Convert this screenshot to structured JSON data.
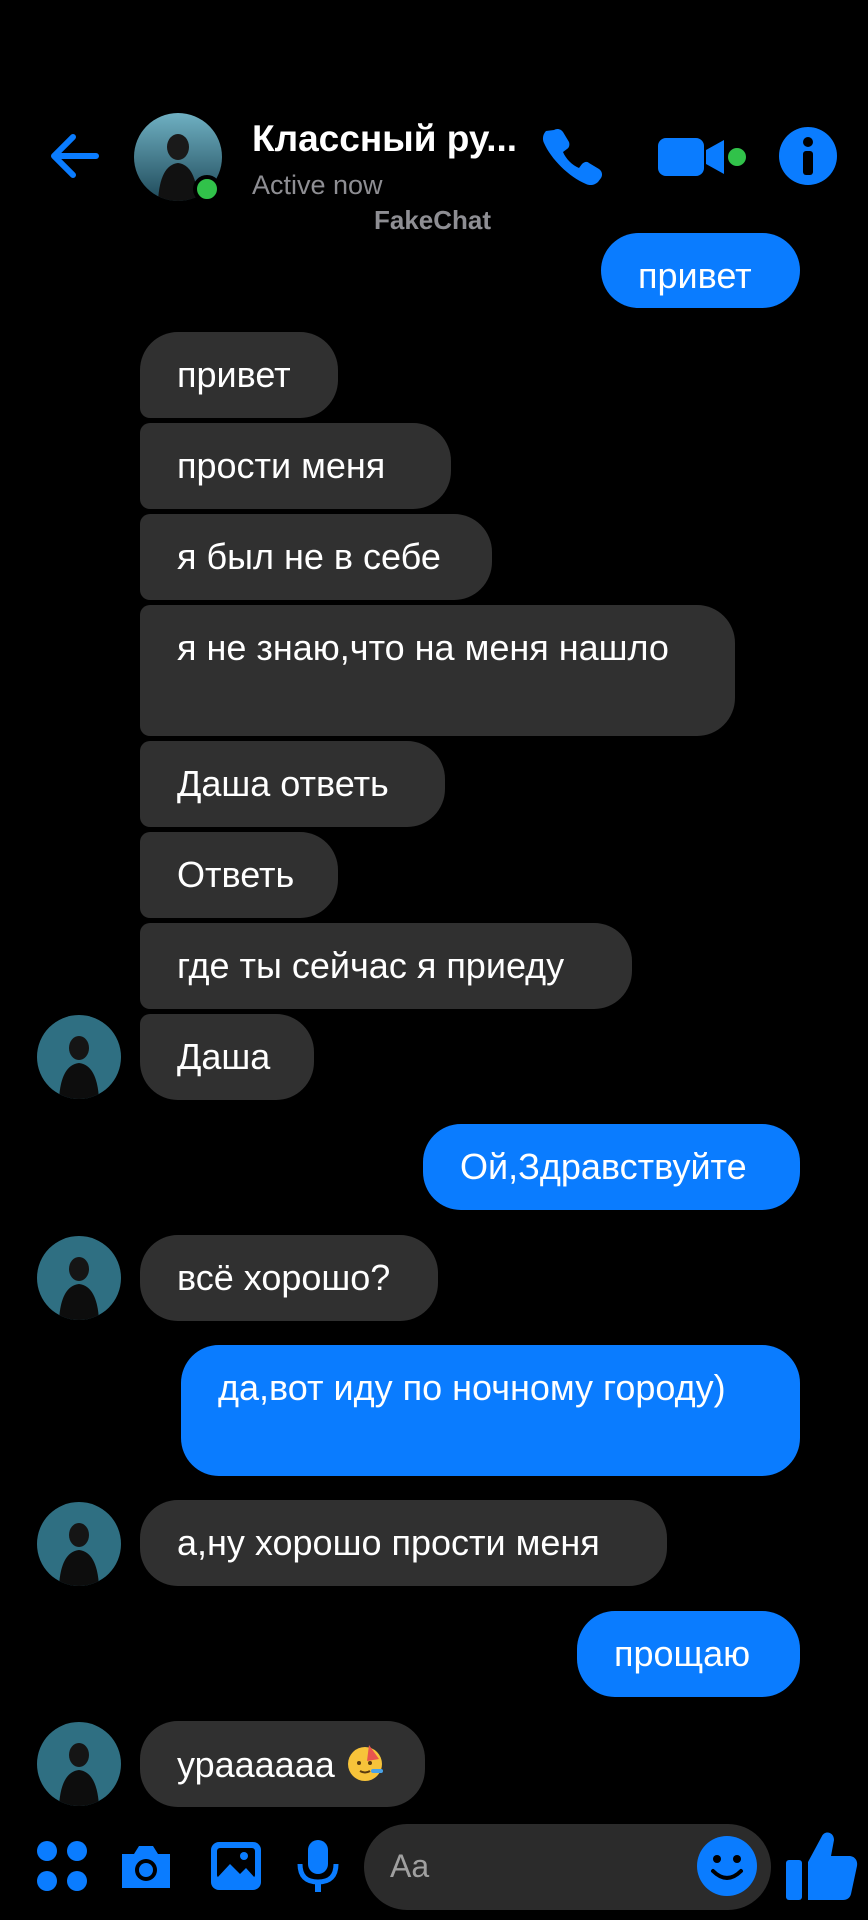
{
  "header": {
    "contact_name": "Классный ру...",
    "status": "Active now",
    "watermark": "FakeChat"
  },
  "messages": [
    {
      "dir": "out",
      "text": "привет"
    },
    {
      "dir": "in",
      "text": "привет"
    },
    {
      "dir": "in",
      "text": "прости меня"
    },
    {
      "dir": "in",
      "text": "я был не в себе"
    },
    {
      "dir": "in",
      "text": "я не знаю,что на меня нашло"
    },
    {
      "dir": "in",
      "text": "Даша ответь"
    },
    {
      "dir": "in",
      "text": "Ответь"
    },
    {
      "dir": "in",
      "text": "где ты сейчас я приеду"
    },
    {
      "dir": "in",
      "text": "Даша"
    },
    {
      "dir": "out",
      "text": "Ой,Здравствуйте"
    },
    {
      "dir": "in",
      "text": "всё хорошо?"
    },
    {
      "dir": "out",
      "text": "да,вот иду по ночному городу)"
    },
    {
      "dir": "in",
      "text": "а,ну хорошо прости меня"
    },
    {
      "dir": "out",
      "text": "прощаю"
    },
    {
      "dir": "in",
      "text": "урааааaa"
    }
  ],
  "composer": {
    "placeholder": "Aa"
  },
  "icons": {
    "back": "arrow-left-icon",
    "call": "phone-icon",
    "video": "video-camera-icon",
    "info": "info-icon",
    "apps": "four-dots-icon",
    "camera": "camera-icon",
    "gallery": "image-icon",
    "mic": "microphone-icon",
    "emoji": "smiley-icon",
    "like": "thumbs-up-icon",
    "party": "party-face-emoji"
  },
  "colors": {
    "accent": "#0a7cff",
    "incoming_bubble": "#303030",
    "background": "#000000",
    "online": "#31c24a"
  }
}
